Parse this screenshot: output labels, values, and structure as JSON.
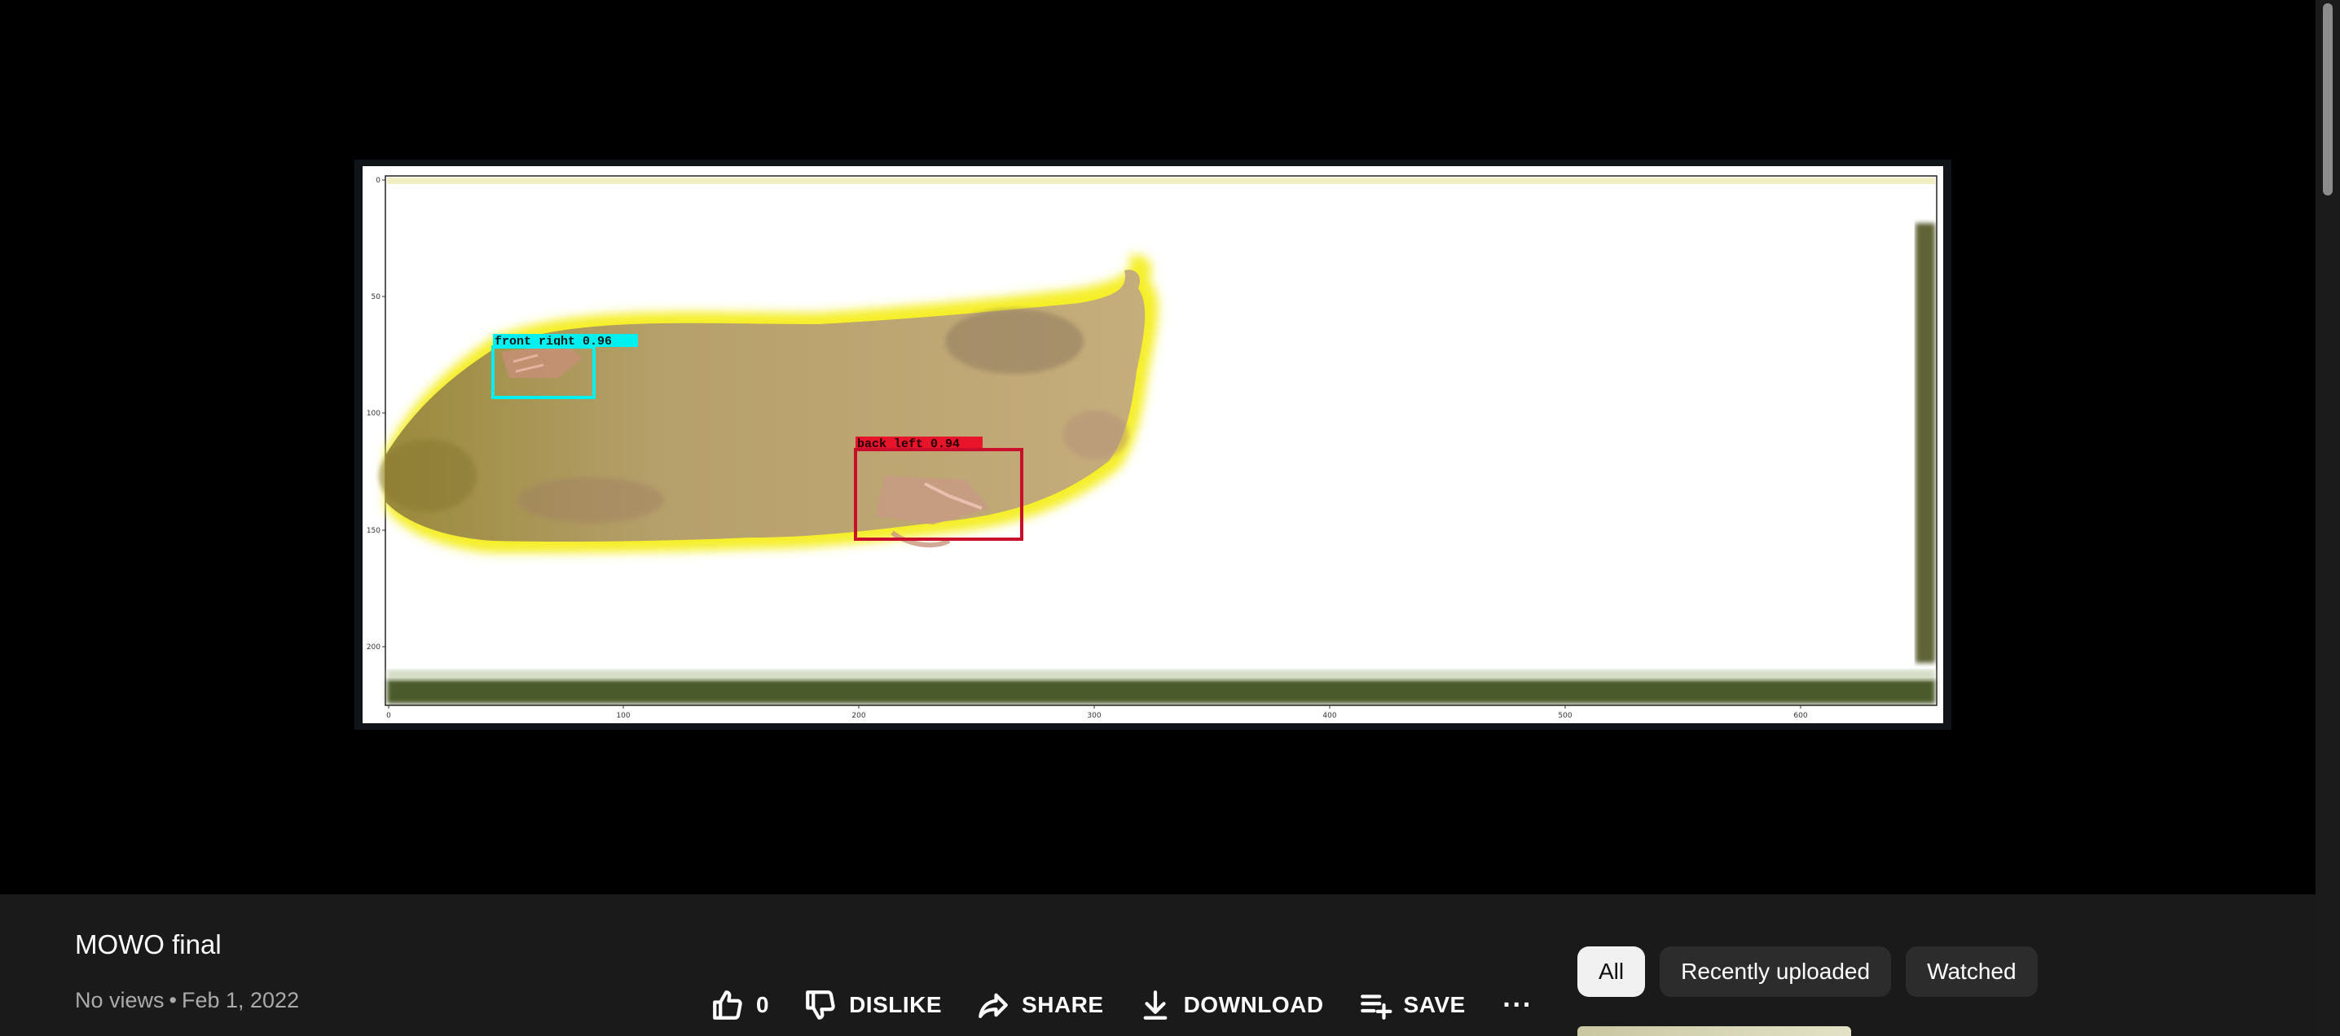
{
  "video": {
    "title": "MOWO final",
    "views": "No views",
    "date": "Feb 1, 2022",
    "separator": "•"
  },
  "frame": {
    "detections": [
      {
        "label": "front right 0.96",
        "color": "#00f0f0"
      },
      {
        "label": "back left 0.94",
        "color": "#e8142a"
      }
    ],
    "y_ticks": [
      "0",
      "50",
      "100",
      "150",
      "200"
    ],
    "x_ticks": [
      "0",
      "100",
      "200",
      "300",
      "400",
      "500",
      "600"
    ]
  },
  "actions": {
    "like_count": "0",
    "dislike": "DISLIKE",
    "share": "SHARE",
    "download": "DOWNLOAD",
    "save": "SAVE",
    "more": "···"
  },
  "chips": [
    "All",
    "Recently uploaded",
    "Watched"
  ],
  "icons": [
    "like-icon",
    "dislike-icon",
    "share-icon",
    "download-icon",
    "save-playlist-icon",
    "more-icon"
  ],
  "colors": {
    "background": "#0f0f0f",
    "panel": "#1a1a1a",
    "chip": "#2c2c2c",
    "chip_active": "#f1f1f1",
    "secondary_text": "#aaaaaa"
  }
}
